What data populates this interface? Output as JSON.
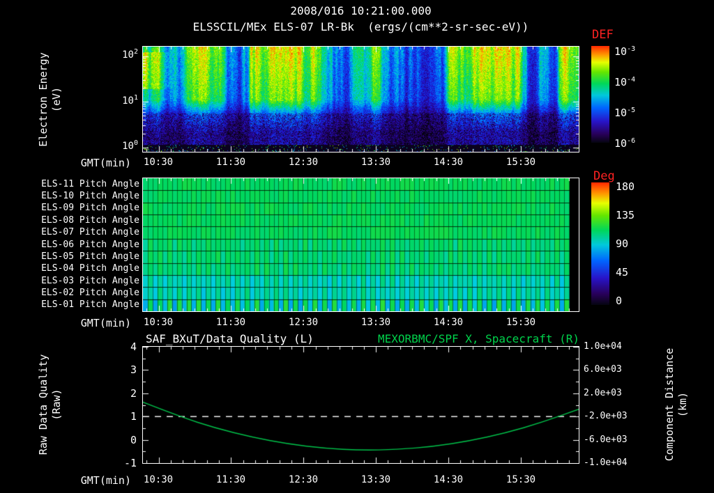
{
  "header": {
    "timestamp": "2008/016 10:21:00.000",
    "title": "ELSSCIL/MEx ELS-07 LR-Bk  (ergs/(cm**2-sr-sec-eV))"
  },
  "time_axis": {
    "label": "GMT(min)",
    "ticks": [
      "10:30",
      "11:30",
      "12:30",
      "13:30",
      "14:30",
      "15:30"
    ]
  },
  "spectrogram_panel": {
    "ylabel_line1": "Electron Energy",
    "ylabel_line2": "(eV)",
    "yticks": [
      {
        "base": "10",
        "exp": "2"
      },
      {
        "base": "10",
        "exp": "1"
      },
      {
        "base": "10",
        "exp": "0"
      }
    ],
    "colorbar": {
      "title": "DEF",
      "ticks": [
        {
          "base": "10",
          "exp": "-3"
        },
        {
          "base": "10",
          "exp": "-4"
        },
        {
          "base": "10",
          "exp": "-5"
        },
        {
          "base": "10",
          "exp": "-6"
        }
      ]
    }
  },
  "pitch_panel": {
    "row_labels": [
      "ELS-11 Pitch Angle",
      "ELS-10 Pitch Angle",
      "ELS-09 Pitch Angle",
      "ELS-08 Pitch Angle",
      "ELS-07 Pitch Angle",
      "ELS-06 Pitch Angle",
      "ELS-05 Pitch Angle",
      "ELS-04 Pitch Angle",
      "ELS-03 Pitch Angle",
      "ELS-02 Pitch Angle",
      "ELS-01 Pitch Angle"
    ],
    "colorbar": {
      "title": "Deg",
      "ticks": [
        "180",
        "135",
        "90",
        "45",
        "0"
      ]
    }
  },
  "line_panel": {
    "title_left": "SAF_BXuT/Data Quality (L)",
    "title_right": "MEXORBMC/SPF X, Spacecraft (R)",
    "ylabel_left_line1": "Raw Data Quality",
    "ylabel_left_line2": "(Raw)",
    "ylabel_right_line1": "Component Distance",
    "ylabel_right_line2": "(km)",
    "left_ticks": [
      "4",
      "3",
      "2",
      "1",
      "0",
      "-1"
    ],
    "right_ticks": [
      "1.0e+04",
      "6.0e+03",
      "2.0e+03",
      "-2.0e+03",
      "-6.0e+03",
      "-1.0e+04"
    ]
  },
  "colors": {
    "background": "#000000",
    "text": "#ffffff",
    "red_label": "#ff2222",
    "green_label": "#00d24b",
    "curve_green": "#00c24a",
    "dashed_white": "#f0f0f0"
  },
  "chart_data": [
    {
      "type": "heatmap",
      "name": "electron-energy-spectrogram",
      "title": "ELSSCIL/MEx ELS-07 LR-Bk",
      "units": "ergs/(cm**2-sr-sec-eV)",
      "x_axis": {
        "label": "GMT(min)",
        "range_hours": [
          10.283,
          16.3
        ],
        "tick_labels": [
          "10:30",
          "11:30",
          "12:30",
          "13:30",
          "14:30",
          "15:30"
        ]
      },
      "y_axis": {
        "label": "Electron Energy (eV)",
        "scale": "log",
        "range": [
          1,
          160
        ]
      },
      "z_axis": {
        "label": "DEF",
        "scale": "log",
        "range": [
          1e-06,
          0.001
        ]
      },
      "description": "Turbulent electron flux: bright green/cyan vertical striations between ~8 and 160 eV around 1e-4; bright yellow-green patch near 10:25 at 30-100 eV; sparse dark blue/purple speckle below ~6 eV; near-black band at ~1 eV with rare colored speckles.",
      "render_seed": 20080416
    },
    {
      "type": "heatmap",
      "name": "pitch-angle-panels",
      "rows": [
        "ELS-11 Pitch Angle",
        "ELS-10 Pitch Angle",
        "ELS-09 Pitch Angle",
        "ELS-08 Pitch Angle",
        "ELS-07 Pitch Angle",
        "ELS-06 Pitch Angle",
        "ELS-05 Pitch Angle",
        "ELS-04 Pitch Angle",
        "ELS-03 Pitch Angle",
        "ELS-02 Pitch Angle",
        "ELS-01 Pitch Angle"
      ],
      "x_axis": {
        "label": "GMT(min)",
        "range_hours": [
          10.283,
          16.3
        ],
        "tick_labels": [
          "10:30",
          "11:30",
          "12:30",
          "13:30",
          "14:30",
          "15:30"
        ]
      },
      "z_axis": {
        "label": "Deg",
        "range": [
          0,
          180
        ]
      },
      "typical_values_deg": {
        "upper_rows": 108,
        "mid_rows": [
          100,
          108
        ],
        "lower_rows": [
          88,
          100
        ],
        "bottom_row_stripes": [
          80,
          112
        ]
      },
      "note": "Nearly uniform green (~105 deg) grid of cells; cyan vertical striping in lower rows; black gap column at right edge.",
      "render_seed": 424242
    },
    {
      "type": "line",
      "name": "quality-and-spacecraft-x",
      "series": [
        {
          "name": "SAF_BXuT/Data Quality (L)",
          "axis": "left",
          "style": "dashed",
          "color": "#f0f0f0",
          "points": [
            [
              10.283,
              1
            ],
            [
              16.3,
              1
            ]
          ]
        },
        {
          "name": "MEXORBMC/SPF X, Spacecraft (R)",
          "axis": "right",
          "style": "solid",
          "color": "#00c24a",
          "points": [
            [
              10.28,
              480
            ],
            [
              10.78,
              -1956
            ],
            [
              11.28,
              -3972
            ],
            [
              11.79,
              -5560
            ],
            [
              12.29,
              -6728
            ],
            [
              12.79,
              -7468
            ],
            [
              13.29,
              -7788
            ],
            [
              13.79,
              -7680
            ],
            [
              14.29,
              -7152
            ],
            [
              14.79,
              -6196
            ],
            [
              15.29,
              -4820
            ],
            [
              15.79,
              -3016
            ],
            [
              16.3,
              -744
            ]
          ]
        }
      ],
      "x_axis": {
        "label": "GMT(min)",
        "range_hours": [
          10.283,
          16.3
        ],
        "tick_labels": [
          "10:30",
          "11:30",
          "12:30",
          "13:30",
          "14:30",
          "15:30"
        ]
      },
      "left_axis": {
        "label": "Raw Data Quality (Raw)",
        "range": [
          -1,
          4
        ]
      },
      "right_axis": {
        "label": "Component Distance (km)",
        "range": [
          -10000,
          10000
        ]
      }
    }
  ]
}
